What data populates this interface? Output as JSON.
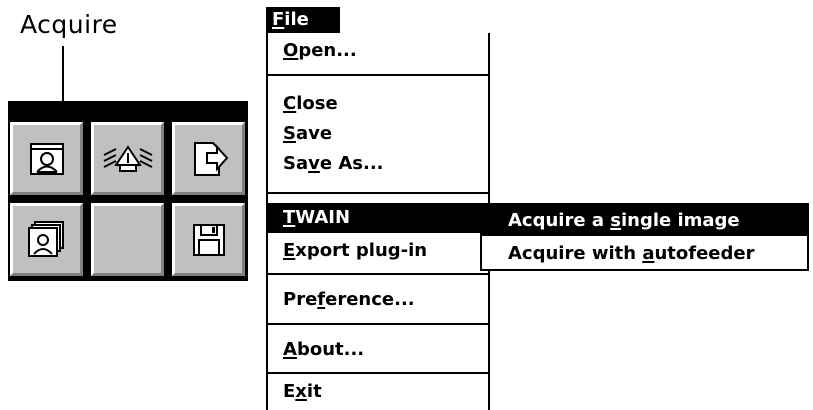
{
  "callout": {
    "label": "Acquire"
  },
  "palette": {
    "tools": [
      {
        "icon": "acquire-icon",
        "kind": "acquire"
      },
      {
        "icon": "twain-source-icon",
        "kind": "twain"
      },
      {
        "icon": "export-icon",
        "kind": "export"
      },
      {
        "icon": "acquire-multiple-icon",
        "kind": "acquire-multi"
      },
      {
        "icon": "blank",
        "kind": "blank"
      },
      {
        "icon": "save-icon",
        "kind": "save"
      }
    ]
  },
  "menu": {
    "title": {
      "mnemonic": "F",
      "rest": "ile"
    },
    "items": {
      "open": {
        "pre": "",
        "mnemonic": "O",
        "post": "pen..."
      },
      "close": {
        "pre": "",
        "mnemonic": "C",
        "post": "lose"
      },
      "save": {
        "pre": "",
        "mnemonic": "S",
        "post": "ave"
      },
      "save_as": {
        "pre": "Sa",
        "mnemonic": "v",
        "post": "e As..."
      },
      "twain": {
        "pre": "",
        "mnemonic": "T",
        "post": "WAIN"
      },
      "export": {
        "pre": "",
        "mnemonic": "E",
        "post": "xport plug-in"
      },
      "preference": {
        "pre": "Pre",
        "mnemonic": "f",
        "post": "erence..."
      },
      "about": {
        "pre": "",
        "mnemonic": "A",
        "post": "bout..."
      },
      "exit": {
        "pre": "E",
        "mnemonic": "x",
        "post": "it"
      }
    }
  },
  "twain_submenu": {
    "single": {
      "pre": "Acquire a ",
      "mnemonic": "s",
      "post": "ingle image"
    },
    "autofeeder": {
      "pre": "Acquire with ",
      "mnemonic": "a",
      "post": "utofeeder"
    }
  },
  "colors": {
    "face": "#c0c0c0",
    "highlight": "#ffffff",
    "shadow": "#808080",
    "selection": "#000000"
  }
}
